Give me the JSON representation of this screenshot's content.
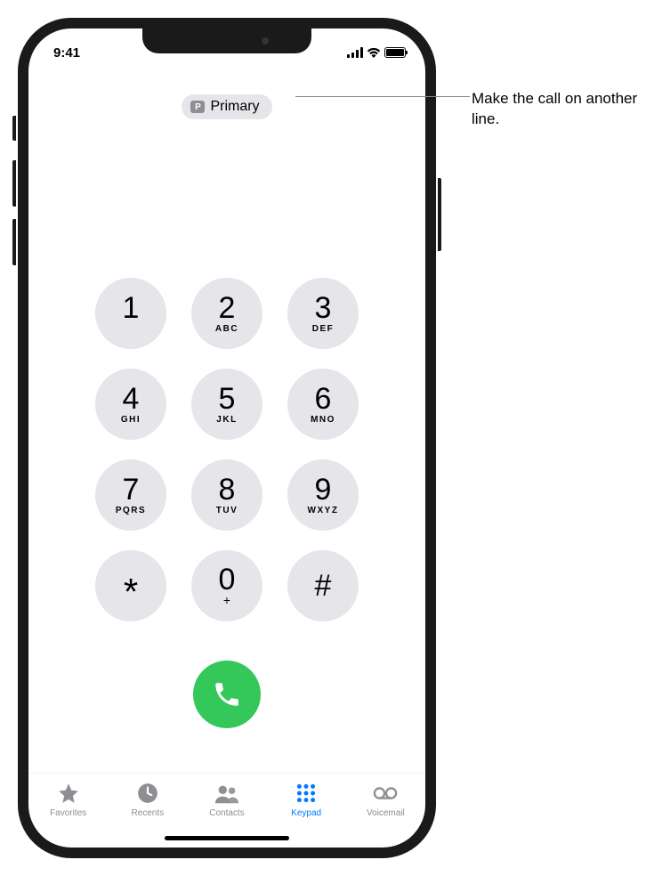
{
  "status": {
    "time": "9:41"
  },
  "line_selector": {
    "badge": "P",
    "label": "Primary"
  },
  "keypad": [
    {
      "digit": "1",
      "letters": ""
    },
    {
      "digit": "2",
      "letters": "ABC"
    },
    {
      "digit": "3",
      "letters": "DEF"
    },
    {
      "digit": "4",
      "letters": "GHI"
    },
    {
      "digit": "5",
      "letters": "JKL"
    },
    {
      "digit": "6",
      "letters": "MNO"
    },
    {
      "digit": "7",
      "letters": "PQRS"
    },
    {
      "digit": "8",
      "letters": "TUV"
    },
    {
      "digit": "9",
      "letters": "WXYZ"
    },
    {
      "digit": "*",
      "letters": ""
    },
    {
      "digit": "0",
      "letters": "+"
    },
    {
      "digit": "#",
      "letters": ""
    }
  ],
  "tabs": [
    {
      "id": "favorites",
      "label": "Favorites",
      "active": false
    },
    {
      "id": "recents",
      "label": "Recents",
      "active": false
    },
    {
      "id": "contacts",
      "label": "Contacts",
      "active": false
    },
    {
      "id": "keypad",
      "label": "Keypad",
      "active": true
    },
    {
      "id": "voicemail",
      "label": "Voicemail",
      "active": false
    }
  ],
  "callout": {
    "text": "Make the call on another line."
  },
  "colors": {
    "call_green": "#34c759",
    "key_bg": "#e5e5ea",
    "active_blue": "#007aff",
    "inactive_gray": "#8e8e93"
  }
}
